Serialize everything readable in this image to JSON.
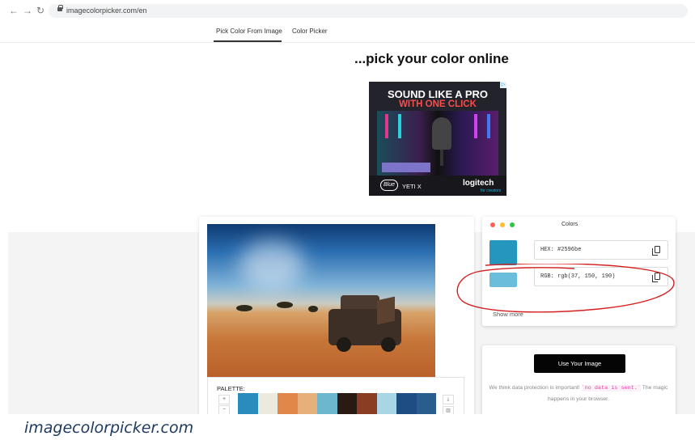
{
  "browser": {
    "back_icon": "arrow-left-icon",
    "forward_icon": "arrow-right-icon",
    "reload_icon": "reload-icon",
    "url": "imagecolorpicker.com/en"
  },
  "nav": {
    "tabs": [
      {
        "label": "Pick Color From Image",
        "active": true
      },
      {
        "label": "Color Picker",
        "active": false
      }
    ]
  },
  "headline": "...pick your color online",
  "ad": {
    "line1": "SOUND LIKE A PRO",
    "line2": "WITH ONE CLICK",
    "brand_logo": "Blue",
    "product": "YETI X",
    "advertiser": "logitech",
    "advertiser_sub": "for creators",
    "accent_red": "#ff4a4a"
  },
  "palette": {
    "label": "PALETTE:",
    "zoom_in": "+",
    "zoom_out": "−",
    "swatches": [
      "#2a8cbd",
      "#ece9df",
      "#e2874a",
      "#e6b07a",
      "#6cb7cd",
      "#2a1a14",
      "#8a3d22",
      "#a8d6e4",
      "#1d4d82",
      "#285d8d"
    ]
  },
  "colors_panel": {
    "title": "Colors",
    "window_dots": [
      "#ff5f57",
      "#febc2e",
      "#28c840"
    ],
    "primary_color": "#2596be",
    "secondary_color": "#6abedc",
    "hex_text": "HEX: #2596be",
    "rgb_text": "RGB: rgb(37, 150, 190)",
    "show_more": "Show more",
    "annotation_color": "#d42020"
  },
  "upload": {
    "button": "Use Your Image",
    "privacy_prefix": "We think data protection is important! ",
    "privacy_code": "`no data is sent.`",
    "privacy_suffix": " The magic happens in your browser."
  },
  "watermark": "imagecolorpicker.com"
}
